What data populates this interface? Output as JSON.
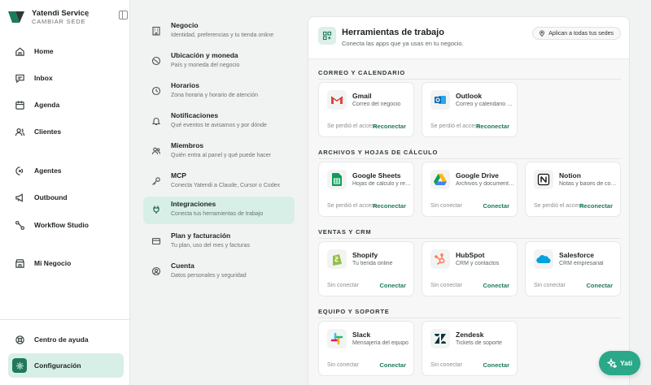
{
  "brand": {
    "name": "Yatendi Service",
    "subtitle": "CAMBIAR SEDE",
    "switch_glyph": "⇕"
  },
  "sidebar": {
    "items": [
      {
        "label": "Home",
        "icon": "home-icon"
      },
      {
        "label": "Inbox",
        "icon": "inbox-icon"
      },
      {
        "label": "Agenda",
        "icon": "calendar-icon"
      },
      {
        "label": "Clientes",
        "icon": "users-icon"
      },
      {
        "label": "Agentes",
        "icon": "agent-icon"
      },
      {
        "label": "Outbound",
        "icon": "megaphone-icon"
      },
      {
        "label": "Workflow Studio",
        "icon": "workflow-icon"
      },
      {
        "label": "Mi Negocio",
        "icon": "store-icon"
      }
    ],
    "footer": [
      {
        "label": "Centro de ayuda",
        "icon": "help-icon"
      },
      {
        "label": "Configuración",
        "icon": "gear-icon",
        "active": true
      }
    ]
  },
  "settings_menu": [
    {
      "title": "Negocio",
      "desc": "Identidad, preferencias y tu tienda online",
      "icon": "building-icon"
    },
    {
      "title": "Ubicación y moneda",
      "desc": "País y moneda del negocio",
      "icon": "globe-icon"
    },
    {
      "title": "Horarios",
      "desc": "Zona horaria y horario de atención",
      "icon": "clock-icon"
    },
    {
      "title": "Notificaciones",
      "desc": "Qué eventos te avisamos y por dónde",
      "icon": "bell-icon"
    },
    {
      "title": "Miembros",
      "desc": "Quién entra al panel y qué puede hacer",
      "icon": "members-icon"
    },
    {
      "title": "MCP",
      "desc": "Conecta Yatendi a Claude, Cursor o Codex",
      "icon": "key-icon"
    },
    {
      "title": "Integraciones",
      "desc": "Conecta tus herramientas de trabajo",
      "icon": "plug-icon",
      "active": true
    },
    {
      "title": "Plan y facturación",
      "desc": "Tu plan, uso del mes y facturas",
      "icon": "card-icon"
    },
    {
      "title": "Cuenta",
      "desc": "Datos personales y seguridad",
      "icon": "account-icon"
    }
  ],
  "panel": {
    "title": "Herramientas de trabajo",
    "subtitle": "Conecta las apps que ya usas en tu negocio.",
    "badge": "Aplican a todas tus sedes"
  },
  "sections": [
    {
      "title": "CORREO Y CALENDARIO",
      "cards": [
        {
          "name": "Gmail",
          "desc": "Correo del negocio",
          "status": "Se perdió el acceso",
          "action": "Reconectar",
          "icon": "gmail-icon"
        },
        {
          "name": "Outlook",
          "desc": "Correo y calendario de Microsoft",
          "status": "Se perdió el acceso",
          "action": "Reconectar",
          "icon": "outlook-icon"
        }
      ]
    },
    {
      "title": "ARCHIVOS Y HOJAS DE CÁLCULO",
      "cards": [
        {
          "name": "Google Sheets",
          "desc": "Hojas de cálculo y reportes",
          "status": "Se perdió el acceso",
          "action": "Reconectar",
          "icon": "sheets-icon"
        },
        {
          "name": "Google Drive",
          "desc": "Archivos y documentos",
          "status": "Sin conectar",
          "action": "Conectar",
          "icon": "drive-icon"
        },
        {
          "name": "Notion",
          "desc": "Notas y bases de conocimiento",
          "status": "Se perdió el acceso",
          "action": "Reconectar",
          "icon": "notion-icon"
        }
      ]
    },
    {
      "title": "VENTAS Y CRM",
      "cards": [
        {
          "name": "Shopify",
          "desc": "Tu tienda online",
          "status": "Sin conectar",
          "action": "Conectar",
          "icon": "shopify-icon"
        },
        {
          "name": "HubSpot",
          "desc": "CRM y contactos",
          "status": "Sin conectar",
          "action": "Conectar",
          "icon": "hubspot-icon"
        },
        {
          "name": "Salesforce",
          "desc": "CRM empresarial",
          "status": "Sin conectar",
          "action": "Conectar",
          "icon": "salesforce-icon"
        }
      ]
    },
    {
      "title": "EQUIPO Y SOPORTE",
      "cards": [
        {
          "name": "Slack",
          "desc": "Mensajería del equipo",
          "status": "Sin conectar",
          "action": "Conectar",
          "icon": "slack-icon"
        },
        {
          "name": "Zendesk",
          "desc": "Tickets de soporte",
          "status": "Sin conectar",
          "action": "Conectar",
          "icon": "zendesk-icon"
        }
      ]
    }
  ],
  "assistant_button": {
    "label": "Yati",
    "icon": "sparkle-icon"
  },
  "colors": {
    "accent": "#1f7a5c",
    "accent_bg": "#d8efe8",
    "fab": "#2aa889"
  }
}
